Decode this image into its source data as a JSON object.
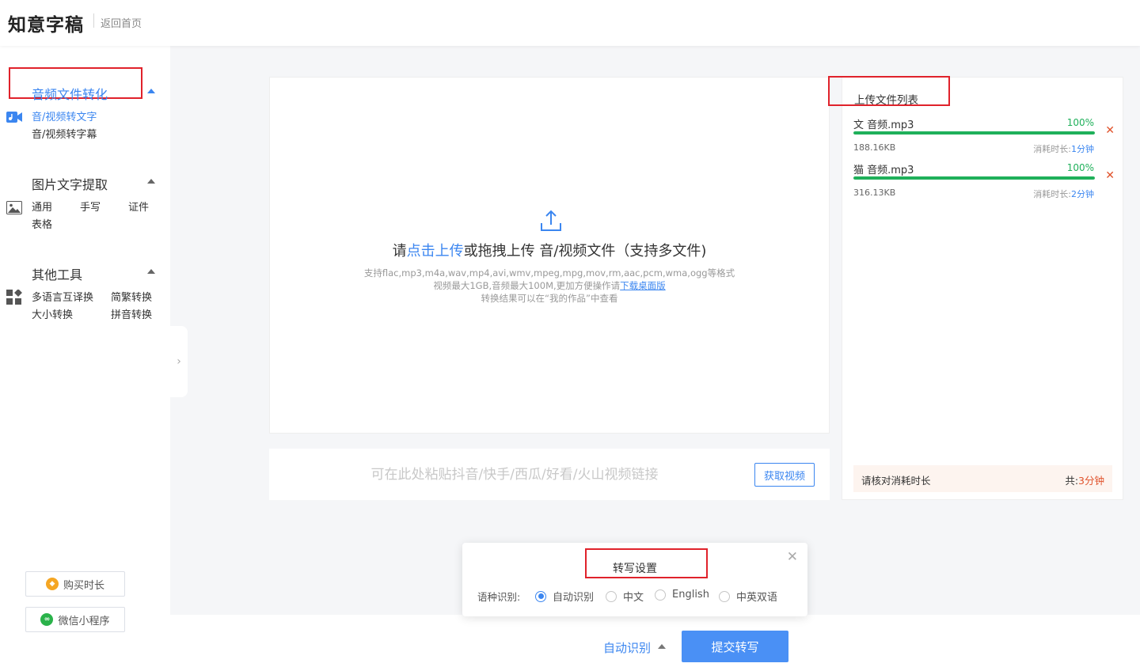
{
  "header": {
    "logo": "知意字稿",
    "back_home": "返回首页"
  },
  "sidebar": {
    "audio_section": {
      "title": "音频文件转化",
      "items": [
        "音/视频转文字",
        "音/视频转字幕"
      ]
    },
    "image_section": {
      "title": "图片文字提取",
      "items": [
        "通用",
        "手写",
        "证件",
        "表格"
      ]
    },
    "tools_section": {
      "title": "其他工具",
      "items": [
        "多语言互译换",
        "简繁转换",
        "大小转换",
        "拼音转换"
      ]
    },
    "buy_button": "购买时长",
    "miniapp_button": "微信小程序"
  },
  "upload": {
    "prefix": "请",
    "link": "点击上传",
    "suffix": "或拖拽上传 音/视频文件（支持多文件)",
    "note_formats": "支持flac,mp3,m4a,wav,mp4,avi,wmv,mpeg,mpg,mov,rm,aac,pcm,wma,ogg等格式",
    "note_size": "视频最大1GB,音频最大100M,更加方便操作请",
    "note_download": "下载桌面版",
    "note_result": "转换结果可以在“我的作品”中查看"
  },
  "link_bar": {
    "placeholder": "可在此处粘贴抖音/快手/西瓜/好看/火山视频链接",
    "button": "获取视频"
  },
  "file_list": {
    "title": "上传文件列表",
    "files": [
      {
        "name": "文 音频.mp3",
        "progress": "100%",
        "progress_value": 1.0,
        "size": "188.16KB",
        "duration_label": "消耗时长:",
        "duration": "1分钟"
      },
      {
        "name": "猫 音频.mp3",
        "progress": "100%",
        "progress_value": 1.0,
        "size": "316.13KB",
        "duration_label": "消耗时长:",
        "duration": "2分钟"
      }
    ],
    "footer_label": "请核对消耗时长",
    "total_label": "共:",
    "total_value": "3分钟"
  },
  "settings_popup": {
    "title": "转写设置",
    "language_label": "语种识别:",
    "options": [
      "自动识别",
      "中文",
      "English",
      "中英双语"
    ],
    "selected": "自动识别"
  },
  "bottom": {
    "auto_detect": "自动识别",
    "submit": "提交转写"
  },
  "colors": {
    "accent": "#3b86f0",
    "success": "#1fb05a",
    "danger": "#e0522b",
    "highlight_box": "#e0222b"
  }
}
